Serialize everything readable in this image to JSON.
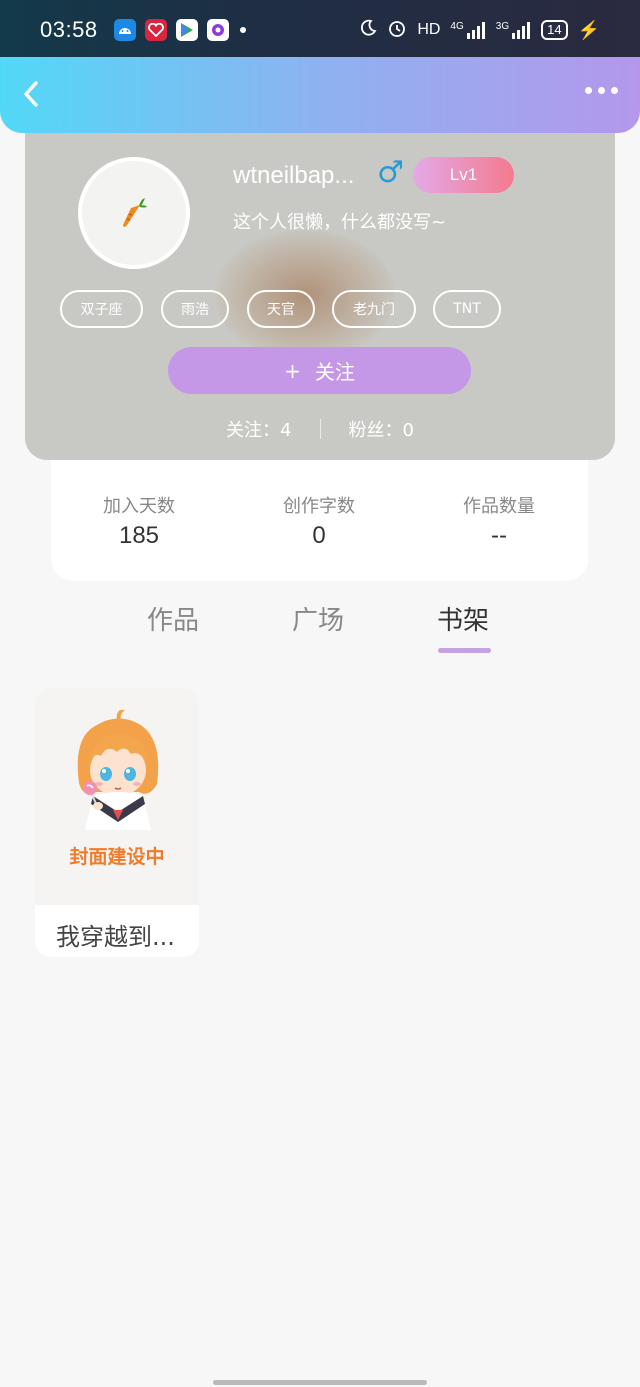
{
  "status_bar": {
    "time": "03:58",
    "hd": "HD",
    "net1": "4G",
    "net2": "3G",
    "battery": "14"
  },
  "header": {
    "back_icon": "chevron-left-icon",
    "more_icon": "more-dots-icon"
  },
  "profile": {
    "username": "wtneilbap...",
    "gender_symbol": "♂",
    "level": "Lv1",
    "bio": "这个人很懒，什么都没写~",
    "tags": [
      "双子座",
      "雨浩",
      "天官",
      "老九门",
      "TNT"
    ],
    "follow_button": "关注",
    "follow_plus": "+",
    "following_label": "关注：4",
    "fans_label": "粉丝：0"
  },
  "stats": [
    {
      "label": "加入天数",
      "value": "185"
    },
    {
      "label": "创作字数",
      "value": "0"
    },
    {
      "label": "作品数量",
      "value": "--"
    }
  ],
  "tabs": [
    "作品",
    "广场",
    "书架"
  ],
  "active_tab": "书架",
  "bookshelf": [
    {
      "title": "我穿越到...",
      "cover_text": "封面建设中"
    }
  ],
  "colors": {
    "accent_purple": "#c498e6",
    "header_gradient_start": "#52d8f7",
    "header_gradient_end": "#b497ec",
    "cover_text": "#ef7c2b"
  }
}
